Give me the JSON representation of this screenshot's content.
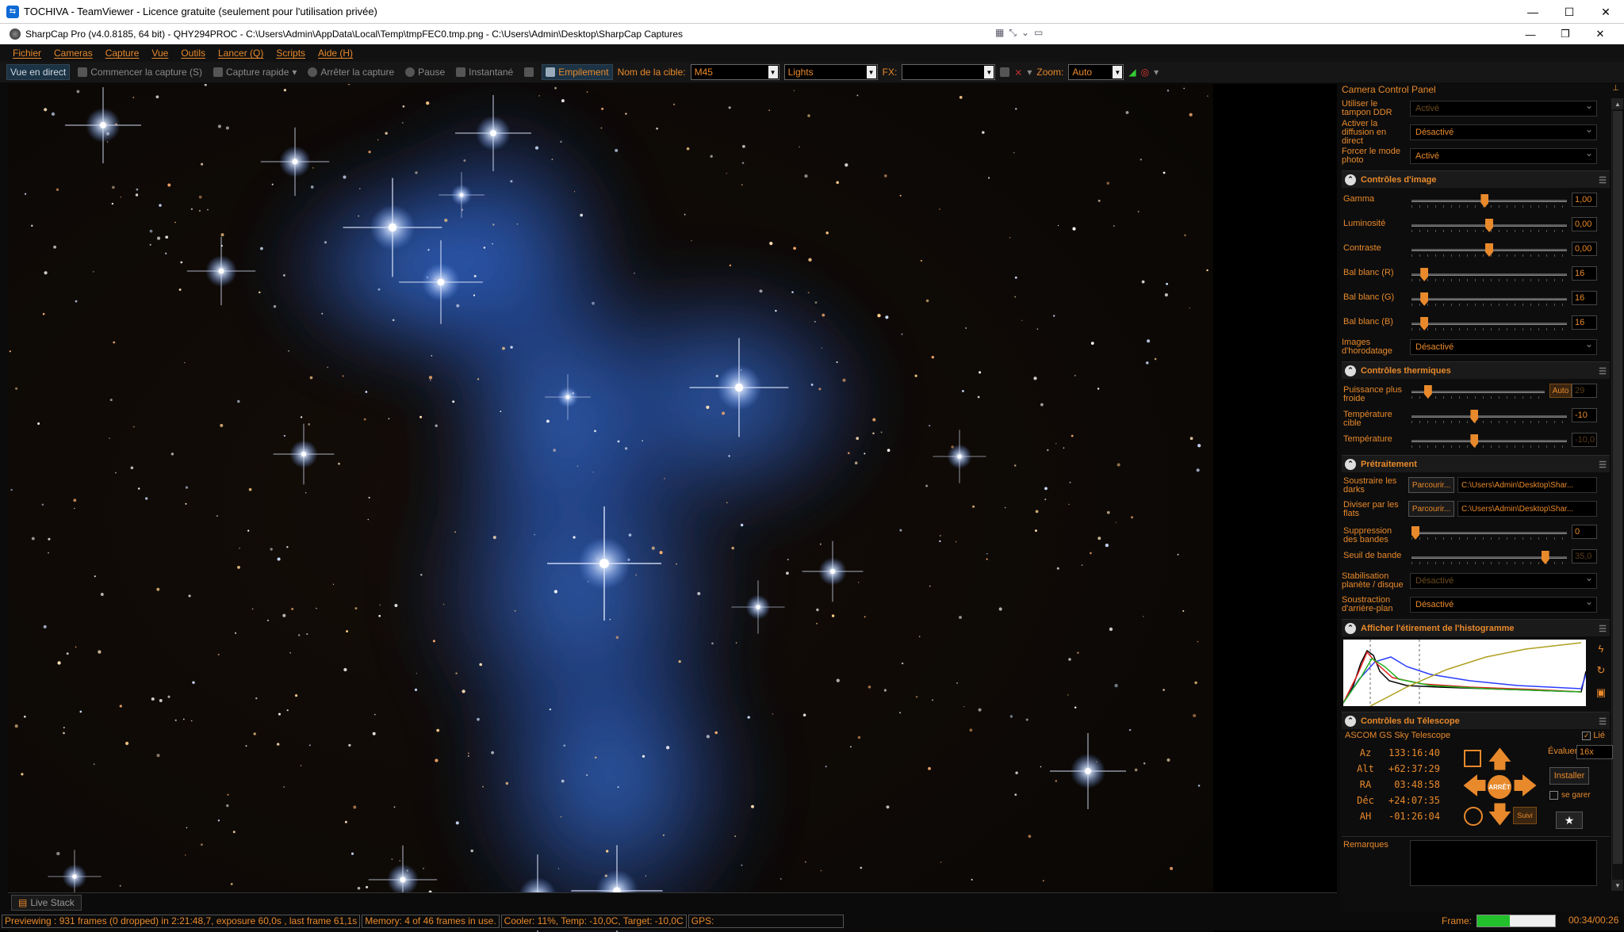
{
  "teamviewer": {
    "title": "TOCHIVA - TeamViewer - Licence gratuite (seulement pour l'utilisation privée)",
    "minimize": "—",
    "maximize": "☐",
    "close": "✕"
  },
  "sharpcap": {
    "title": "SharpCap Pro (v4.0.8185, 64 bit) - QHY294PROC - C:\\Users\\Admin\\AppData\\Local\\Temp\\tmpFEC0.tmp.png - C:\\Users\\Admin\\Desktop\\SharpCap Captures",
    "minimize": "—",
    "restore": "❐",
    "close": "✕"
  },
  "menu": [
    "Fichier",
    "Cameras",
    "Capture",
    "Vue",
    "Outils",
    "Lancer (Q)",
    "Scripts",
    "Aide (H)"
  ],
  "toolbar": {
    "live": "Vue en direct",
    "start_capture": "Commencer la capture (S)",
    "quick_capture": "Capture rapide",
    "stop_capture": "Arrêter la capture",
    "pause": "Pause",
    "snapshot": "Instantané",
    "stack": "Empilement",
    "target_label": "Nom de la cible:",
    "target_value": "M45",
    "frame_type": "Lights",
    "fx_label": "FX:",
    "fx_value": "",
    "zoom_label": "Zoom:",
    "zoom_value": "Auto"
  },
  "panel": {
    "title": "Camera Control Panel",
    "top_rows": [
      {
        "label": "Utiliser le tampon DDR",
        "value": "Activé",
        "dim": true
      },
      {
        "label": "Activer la diffusion en direct",
        "value": "Désactivé",
        "dim": false
      },
      {
        "label": "Forcer le mode photo",
        "value": "Activé",
        "dim": false
      }
    ],
    "image_controls": {
      "title": "Contrôles d'image",
      "sliders": [
        {
          "label": "Gamma",
          "value": "1,00",
          "pos": 0.47
        },
        {
          "label": "Luminosité",
          "value": "0,00",
          "pos": 0.5
        },
        {
          "label": "Contraste",
          "value": "0,00",
          "pos": 0.5
        },
        {
          "label": "Bal blanc (R)",
          "value": "16",
          "pos": 0.06
        },
        {
          "label": "Bal blanc (G)",
          "value": "16",
          "pos": 0.06
        },
        {
          "label": "Bal blanc (B)",
          "value": "16",
          "pos": 0.06
        }
      ],
      "timestamp_label": "Images d'horodatage",
      "timestamp_value": "Désactivé"
    },
    "thermal": {
      "title": "Contrôles thermiques",
      "cooler_label": "Puissance plus froide",
      "cooler_auto": "Auto",
      "cooler_value": "29",
      "cooler_pos": 0.1,
      "target_label": "Température cible",
      "target_value": "-10",
      "target_pos": 0.4,
      "temp_label": "Température",
      "temp_value": "-10,0",
      "temp_pos": 0.4
    },
    "preprocessing": {
      "title": "Prétraitement",
      "darks_label": "Soustraire les darks",
      "flats_label": "Diviser par les flats",
      "browse": "Parcourir...",
      "darks_path": "C:\\Users\\Admin\\Desktop\\Shar...",
      "flats_path": "C:\\Users\\Admin\\Desktop\\Shar...",
      "band_label": "Suppression des bandes",
      "band_value": "0",
      "band_pos": 0.0,
      "threshold_label": "Seuil de bande",
      "threshold_value": "35,0",
      "threshold_pos": 0.88,
      "stab_label": "Stabilisation planète / disque",
      "stab_value": "Désactivé",
      "bg_label": "Soustraction d'arrière-plan",
      "bg_value": "Désactivé"
    },
    "histogram": {
      "title": "Afficher l'étirement de l'histogramme"
    },
    "telescope": {
      "title": "Contrôles du Télescope",
      "name": "ASCOM GS Sky Telescope",
      "linked": "Lié",
      "coords": [
        {
          "k": "Az",
          "v": "133:16:40"
        },
        {
          "k": "Alt",
          "v": "+62:37:29"
        },
        {
          "k": "RA",
          "v": "03:48:58"
        },
        {
          "k": "Déc",
          "v": "+24:07:35"
        },
        {
          "k": "AH",
          "v": "-01:26:04"
        }
      ],
      "stop": "ARRÊT",
      "evaluate_label": "Évaluer:",
      "rate": "16x",
      "install": "Installer",
      "park": "se garer",
      "track": "Suivi"
    },
    "remarks_label": "Remarques"
  },
  "bottom_tab": "Live Stack",
  "status": {
    "preview": "Previewing : 931 frames (0 dropped) in 2:21:48,7, exposure 60,0s , last frame 61,1s",
    "memory": "Memory: 4 of 46 frames in use.",
    "cooler": "Cooler: 11%, Temp: -10,0C, Target: -10,0C",
    "gps": "GPS:",
    "frame_label": "Frame:",
    "frame_progress": 0.42,
    "time": "00:34/00:26"
  },
  "colors": {
    "accent": "#e8892b",
    "nebula": "#2f6bd6"
  }
}
